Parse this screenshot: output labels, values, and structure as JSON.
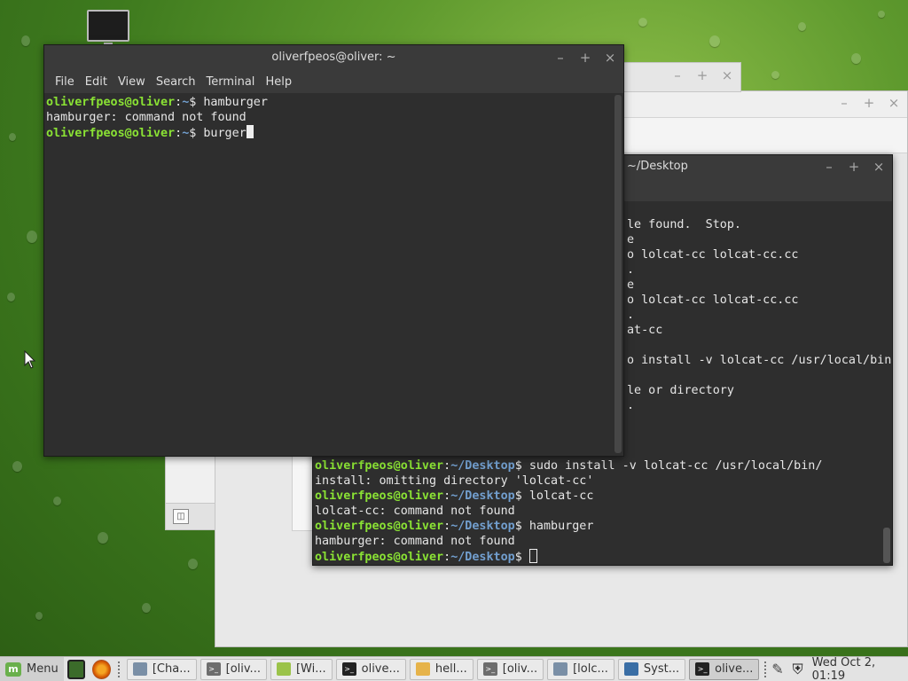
{
  "desktop": {
    "icon_name": "computer-icon"
  },
  "front_terminal": {
    "title": "oliverfpeos@oliver: ~",
    "menu": [
      "File",
      "Edit",
      "View",
      "Search",
      "Terminal",
      "Help"
    ],
    "lines": [
      {
        "user": "oliverfpeos@oliver",
        "path": "~",
        "cmd": "hamburger"
      },
      {
        "out": "hamburger: command not found"
      },
      {
        "user": "oliverfpeos@oliver",
        "path": "~",
        "cmd": "burger"
      }
    ],
    "window_buttons": [
      "–",
      "+",
      "×"
    ]
  },
  "back_terminal": {
    "title": "~/Desktop",
    "partial_lines": [
      "le found.  Stop.",
      "e",
      "o lolcat-cc lolcat-cc.cc",
      ".",
      "e",
      "o lolcat-cc lolcat-cc.cc",
      ".",
      "at-cc",
      "",
      "o install -v lolcat-cc /usr/local/bin",
      "",
      "le or directory",
      "."
    ],
    "lines": [
      {
        "user": "oliverfpeos@oliver",
        "path": "~/Desktop",
        "cmd": "sudo install -v lolcat-cc /usr/local/bin/"
      },
      {
        "out": "install: omitting directory 'lolcat-cc'"
      },
      {
        "user": "oliverfpeos@oliver",
        "path": "~/Desktop",
        "cmd": "lolcat-cc"
      },
      {
        "out": "lolcat-cc: command not found"
      },
      {
        "user": "oliverfpeos@oliver",
        "path": "~/Desktop",
        "cmd": "hamburger"
      },
      {
        "out": "hamburger: command not found"
      },
      {
        "user": "oliverfpeos@oliver",
        "path": "~/Desktop",
        "cmd": ""
      }
    ]
  },
  "taskbar": {
    "menu_label": "Menu",
    "tasks": [
      {
        "label": "[Cha...",
        "icon": "chat-icon",
        "color": "#7a8fa6"
      },
      {
        "label": "[oliv...",
        "icon": "terminal-icon",
        "color": "#6d6d6d"
      },
      {
        "label": "[Wi...",
        "icon": "android-icon",
        "color": "#9bc34a"
      },
      {
        "label": "olive...",
        "icon": "terminal-icon",
        "color": "#222222"
      },
      {
        "label": "hell...",
        "icon": "text-editor-icon",
        "color": "#e6b34a"
      },
      {
        "label": "[oliv...",
        "icon": "terminal-icon",
        "color": "#6d6d6d"
      },
      {
        "label": "[lolc...",
        "icon": "chat-icon",
        "color": "#7a8fa6"
      },
      {
        "label": "Syst...",
        "icon": "window-icon",
        "color": "#3a6ea5"
      },
      {
        "label": "olive...",
        "icon": "terminal-icon",
        "color": "#222222",
        "active": true
      }
    ],
    "clock": "Wed Oct  2, 01:19"
  }
}
